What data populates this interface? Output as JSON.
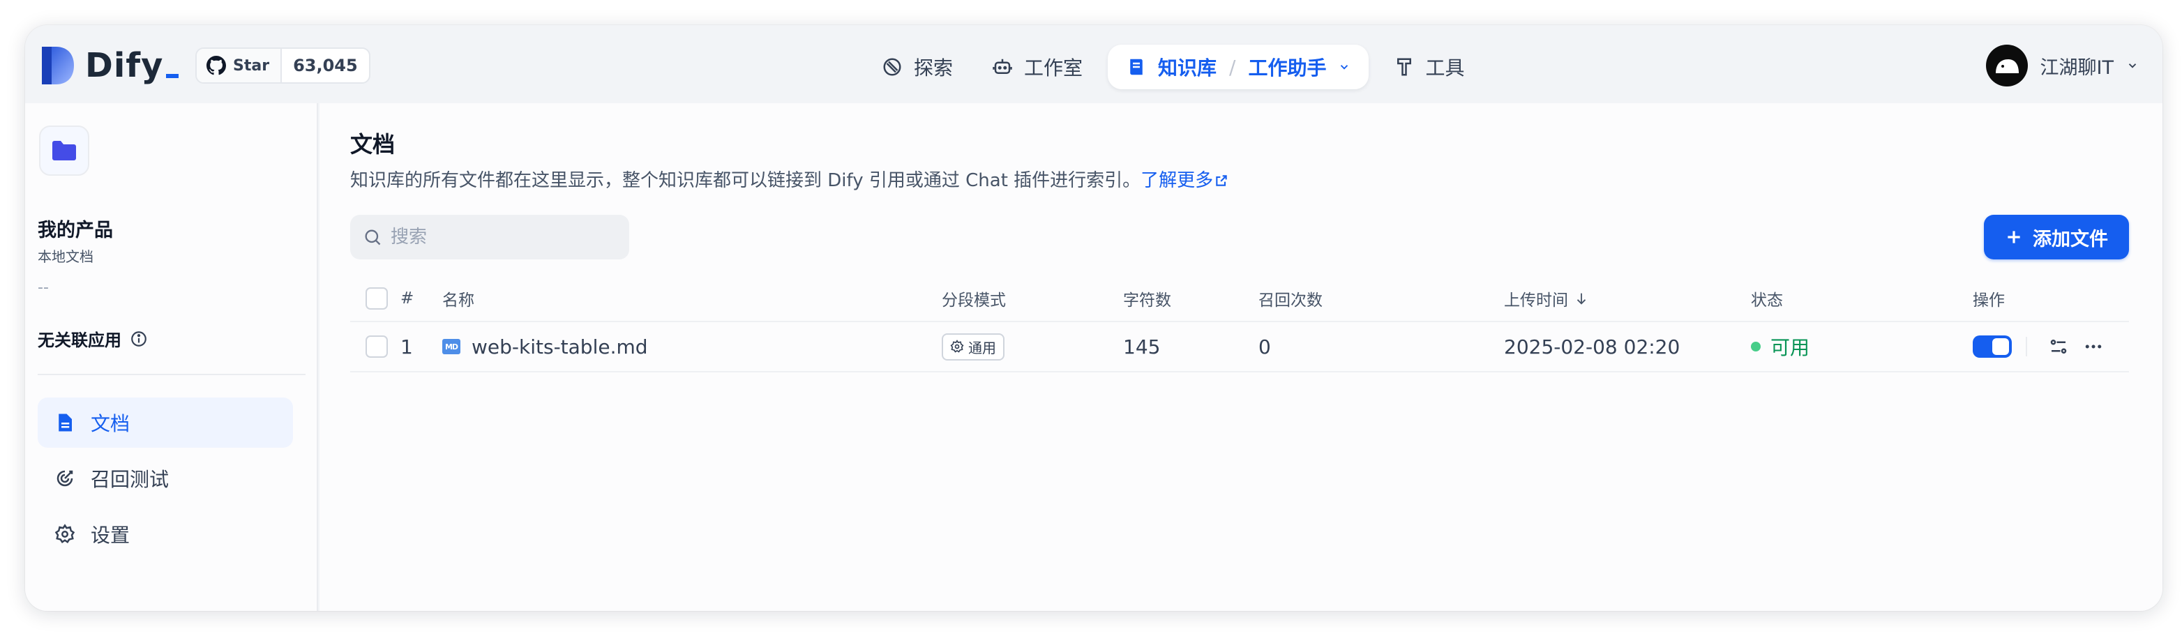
{
  "app": {
    "name": "Dify"
  },
  "github": {
    "star_label": "Star",
    "star_count": "63,045"
  },
  "nav": {
    "items": [
      {
        "label": "探索",
        "icon": "compass-icon"
      },
      {
        "label": "工作室",
        "icon": "robot-icon"
      }
    ],
    "active": {
      "label": "知识库",
      "sub_label": "工作助手",
      "separator": "/",
      "icon": "book-icon"
    },
    "tools": {
      "label": "工具",
      "icon": "hammer-icon"
    }
  },
  "user": {
    "name": "江湖聊IT"
  },
  "sidebar": {
    "dataset_name": "我的产品",
    "dataset_sub": "本地文档",
    "dataset_desc": "--",
    "linked_apps": "无关联应用",
    "items": [
      {
        "label": "文档",
        "icon": "document-icon",
        "active": true
      },
      {
        "label": "召回测试",
        "icon": "target-icon",
        "active": false
      },
      {
        "label": "设置",
        "icon": "gear-icon",
        "active": false
      }
    ]
  },
  "main": {
    "title": "文档",
    "description": "知识库的所有文件都在这里显示，整个知识库都可以链接到 Dify 引用或通过 Chat 插件进行索引。",
    "learn_more": "了解更多",
    "search_placeholder": "搜索",
    "add_button": "添加文件",
    "table": {
      "headers": {
        "index": "#",
        "name": "名称",
        "mode": "分段模式",
        "chars": "字符数",
        "hits": "召回次数",
        "upload_time": "上传时间",
        "status": "状态",
        "actions": "操作"
      },
      "rows": [
        {
          "index": "1",
          "name": "web-kits-table.md",
          "file_type": "MD",
          "mode": "通用",
          "chars": "145",
          "hits": "0",
          "upload_time": "2025-02-08 02:20",
          "status": "可用",
          "enabled": true
        }
      ]
    }
  },
  "colors": {
    "accent": "#155eef",
    "status_green": "#079455",
    "status_dot": "#47cd89"
  }
}
